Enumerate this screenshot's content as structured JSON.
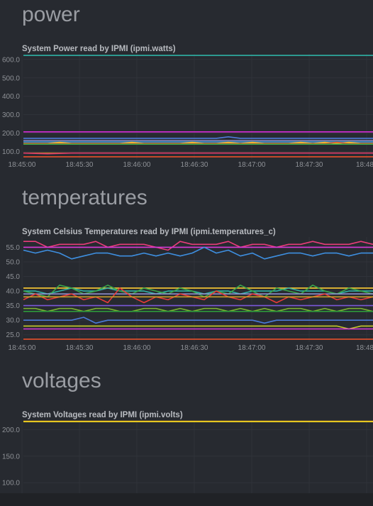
{
  "sections": [
    {
      "title": "power"
    },
    {
      "title": "temperatures"
    },
    {
      "title": "voltages"
    }
  ],
  "chart_data": [
    {
      "type": "line",
      "title": "System Power read by IPMI (ipmi.watts)",
      "xlabel": "",
      "ylabel": "",
      "x_ticks": [
        "18:45:00",
        "18:45:30",
        "18:46:00",
        "18:46:30",
        "18:47:00",
        "18:47:30",
        "18:48:"
      ],
      "y_ticks": [
        "100.0",
        "200.0",
        "300.0",
        "400.0",
        "500.0",
        "600.0"
      ],
      "ylim": [
        60,
        630
      ],
      "grid": true,
      "series": [
        {
          "color": "#2fb2a6",
          "values": [
            622,
            622,
            622,
            622,
            622,
            622,
            622,
            622,
            622,
            622,
            622,
            622,
            622,
            622,
            622,
            622,
            622,
            622,
            622,
            622,
            622,
            622,
            622,
            622,
            622,
            622,
            622,
            622,
            622,
            622
          ]
        },
        {
          "color": "#d62cd6",
          "values": [
            207,
            207,
            207,
            207,
            207,
            207,
            207,
            207,
            207,
            207,
            207,
            207,
            207,
            207,
            207,
            207,
            207,
            207,
            207,
            207,
            207,
            207,
            207,
            207,
            207,
            207,
            207,
            207,
            207,
            207
          ]
        },
        {
          "color": "#4f7ad8",
          "values": [
            172,
            172,
            172,
            172,
            172,
            172,
            172,
            172,
            172,
            172,
            172,
            172,
            172,
            172,
            172,
            172,
            172,
            180,
            172,
            172,
            172,
            172,
            172,
            172,
            172,
            172,
            172,
            172,
            172,
            172
          ]
        },
        {
          "color": "#8e8ec8",
          "values": [
            160,
            160,
            160,
            160,
            160,
            160,
            160,
            160,
            160,
            160,
            160,
            160,
            160,
            160,
            160,
            160,
            160,
            160,
            160,
            160,
            160,
            160,
            160,
            160,
            160,
            160,
            160,
            160,
            160,
            160
          ]
        },
        {
          "color": "#3a9ad9",
          "values": [
            152,
            152,
            152,
            152,
            152,
            152,
            152,
            152,
            152,
            152,
            152,
            152,
            152,
            152,
            152,
            152,
            152,
            152,
            152,
            152,
            152,
            152,
            152,
            152,
            152,
            152,
            152,
            152,
            152,
            152
          ]
        },
        {
          "color": "#ffcc33",
          "values": [
            144,
            144,
            144,
            150,
            144,
            144,
            144,
            144,
            144,
            150,
            144,
            144,
            144,
            144,
            150,
            144,
            144,
            150,
            144,
            150,
            144,
            144,
            144,
            150,
            144,
            150,
            144,
            150,
            144,
            144
          ]
        },
        {
          "color": "#e05a28",
          "values": [
            144,
            144,
            144,
            144,
            144,
            144,
            144,
            144,
            144,
            144,
            144,
            144,
            144,
            144,
            144,
            144,
            144,
            144,
            144,
            144,
            144,
            144,
            144,
            144,
            144,
            144,
            150,
            144,
            144,
            144
          ]
        },
        {
          "color": "#3aa64a",
          "values": [
            140,
            140,
            140,
            140,
            140,
            140,
            140,
            140,
            140,
            140,
            140,
            140,
            140,
            140,
            140,
            140,
            140,
            140,
            140,
            140,
            140,
            140,
            140,
            140,
            140,
            140,
            140,
            140,
            140,
            140
          ]
        },
        {
          "color": "#c98a2a",
          "values": [
            92,
            92,
            92,
            92,
            92,
            92,
            92,
            92,
            92,
            92,
            92,
            92,
            92,
            92,
            92,
            92,
            92,
            92,
            92,
            92,
            92,
            92,
            92,
            92,
            92,
            92,
            92,
            92,
            92,
            92
          ]
        },
        {
          "color": "#d83a6a",
          "values": [
            92,
            90,
            88,
            90,
            92,
            92,
            92,
            92,
            92,
            92,
            92,
            92,
            92,
            92,
            92,
            92,
            92,
            92,
            92,
            92,
            92,
            92,
            92,
            92,
            92,
            92,
            92,
            92,
            92,
            92
          ]
        },
        {
          "color": "#e8502a",
          "values": [
            72,
            72,
            72,
            72,
            72,
            72,
            72,
            72,
            72,
            72,
            72,
            72,
            72,
            72,
            72,
            72,
            72,
            72,
            72,
            72,
            72,
            72,
            72,
            72,
            72,
            72,
            72,
            72,
            72,
            72
          ]
        }
      ]
    },
    {
      "type": "line",
      "title": "System Celsius Temperatures read by IPMI (ipmi.temperatures_c)",
      "xlabel": "",
      "ylabel": "",
      "x_ticks": [
        "18:45:00",
        "18:45:30",
        "18:46:00",
        "18:46:30",
        "18:47:00",
        "18:47:30",
        "18:48:"
      ],
      "y_ticks": [
        "25.0",
        "30.0",
        "35.0",
        "40.0",
        "45.0",
        "50.0",
        "55.0"
      ],
      "ylim": [
        22.5,
        58.5
      ],
      "grid": true,
      "series": [
        {
          "color": "#e83c7a",
          "values": [
            57,
            57,
            55,
            56,
            56,
            56,
            57,
            55,
            56,
            56,
            56,
            55,
            54,
            57,
            56,
            56,
            56,
            57,
            55,
            56,
            56,
            55,
            56,
            56,
            57,
            56,
            56,
            56,
            57,
            56
          ]
        },
        {
          "color": "#d83ad8",
          "values": [
            55,
            55,
            55,
            55,
            55,
            55,
            55,
            55,
            55,
            55,
            55,
            55,
            55,
            55,
            55,
            55,
            55,
            55,
            55,
            55,
            55,
            55,
            55,
            55,
            55,
            55,
            55,
            55,
            55,
            55
          ]
        },
        {
          "color": "#3e8fe0",
          "values": [
            54,
            53,
            54,
            53,
            51,
            52,
            53,
            53,
            52,
            52,
            53,
            52,
            53,
            52,
            53,
            55,
            53,
            54,
            52,
            53,
            51,
            52,
            53,
            53,
            52,
            53,
            53,
            52,
            53,
            53
          ]
        },
        {
          "color": "#ffcc33",
          "values": [
            41,
            41,
            41,
            41,
            41,
            41,
            41,
            41,
            41,
            41,
            41,
            41,
            41,
            41,
            41,
            41,
            41,
            41,
            41,
            41,
            41,
            41,
            41,
            41,
            41,
            41,
            41,
            41,
            41,
            41
          ]
        },
        {
          "color": "#2fb2a6",
          "values": [
            40,
            40,
            39,
            40,
            41,
            40,
            40,
            41,
            40,
            40,
            40,
            39,
            40,
            40,
            40,
            39,
            40,
            40,
            39,
            40,
            40,
            40,
            41,
            40,
            40,
            40,
            39,
            40,
            40,
            40
          ]
        },
        {
          "color": "#3aa64a",
          "values": [
            40,
            39,
            38,
            42,
            41,
            39,
            40,
            42,
            40,
            39,
            41,
            40,
            39,
            41,
            40,
            38,
            40,
            39,
            42,
            40,
            38,
            41,
            40,
            39,
            42,
            40,
            39,
            41,
            40,
            39
          ]
        },
        {
          "color": "#8e8ec8",
          "values": [
            39,
            39,
            39,
            39,
            39,
            39,
            39,
            39,
            39,
            39,
            39,
            39,
            39,
            39,
            39,
            39,
            39,
            39,
            39,
            39,
            39,
            39,
            39,
            39,
            39,
            39,
            39,
            39,
            39,
            39
          ]
        },
        {
          "color": "#e83a3a",
          "values": [
            37,
            39,
            37,
            38,
            39,
            37,
            38,
            36,
            41,
            38,
            36,
            38,
            37,
            39,
            38,
            37,
            40,
            38,
            37,
            39,
            38,
            36,
            38,
            37,
            38,
            39,
            37,
            38,
            37,
            38
          ]
        },
        {
          "color": "#c9a02a",
          "values": [
            38,
            38,
            38,
            38,
            38,
            38,
            38,
            38,
            38,
            38,
            38,
            38,
            38,
            38,
            38,
            38,
            38,
            38,
            38,
            38,
            38,
            38,
            38,
            38,
            38,
            38,
            38,
            38,
            38,
            38
          ]
        },
        {
          "color": "#7a58d8",
          "values": [
            35,
            35,
            35,
            35,
            35,
            35,
            35,
            35,
            35,
            35,
            35,
            35,
            35,
            35,
            35,
            35,
            35,
            35,
            35,
            35,
            35,
            35,
            35,
            35,
            35,
            35,
            35,
            35,
            35,
            35
          ]
        },
        {
          "color": "#7ab030",
          "values": [
            34,
            34,
            33,
            34,
            34,
            33,
            34,
            34,
            33,
            33,
            34,
            34,
            33,
            34,
            33,
            34,
            34,
            33,
            34,
            33,
            34,
            33,
            34,
            34,
            33,
            34,
            33,
            34,
            34,
            33
          ]
        },
        {
          "color": "#2e9a3a",
          "values": [
            33,
            33,
            33,
            33,
            33,
            33,
            33,
            33,
            33,
            33,
            33,
            33,
            33,
            33,
            33,
            33,
            33,
            33,
            33,
            33,
            33,
            33,
            33,
            33,
            33,
            33,
            33,
            33,
            33,
            33
          ]
        },
        {
          "color": "#4a7ad8",
          "values": [
            30,
            30,
            30,
            30,
            30,
            31,
            29,
            30,
            30,
            30,
            30,
            30,
            30,
            30,
            30,
            30,
            30,
            30,
            30,
            30,
            29,
            30,
            30,
            30,
            30,
            30,
            30,
            30,
            30,
            30
          ]
        },
        {
          "color": "#c9c92a",
          "values": [
            28,
            28,
            28,
            28,
            28,
            28,
            28,
            28,
            28,
            28,
            28,
            28,
            28,
            28,
            28,
            28,
            28,
            28,
            28,
            28,
            28,
            28,
            28,
            28,
            28,
            28,
            28,
            27,
            28,
            28
          ]
        },
        {
          "color": "#d83ad8",
          "values": [
            27,
            27,
            27,
            27,
            27,
            27,
            27,
            27,
            27,
            27,
            27,
            27,
            27,
            27,
            27,
            27,
            27,
            27,
            27,
            27,
            27,
            27,
            27,
            27,
            27,
            27,
            27,
            27,
            27,
            27
          ]
        },
        {
          "color": "#e8502a",
          "values": [
            23.5,
            23.5,
            23.5,
            23.5,
            23.5,
            23.5,
            23.5,
            23.5,
            23.5,
            23.5,
            23.5,
            23.5,
            23.5,
            23.5,
            23.5,
            23.5,
            23.5,
            23.5,
            23.5,
            23.5,
            23.5,
            23.5,
            23.5,
            23.5,
            23.5,
            23.5,
            23.5,
            23.5,
            23.5,
            23.5
          ]
        }
      ]
    },
    {
      "type": "line",
      "title": "System Voltages read by IPMI (ipmi.volts)",
      "xlabel": "",
      "ylabel": "",
      "x_ticks": [],
      "y_ticks": [
        "100.0",
        "150.0",
        "200.0"
      ],
      "ylim": [
        80,
        218
      ],
      "grid": true,
      "series": [
        {
          "color": "#e0a020",
          "values": [
            216,
            216,
            216,
            216,
            216,
            216,
            216,
            216,
            216,
            216,
            216,
            216,
            216,
            216,
            216,
            216,
            216,
            216,
            216,
            216,
            216,
            216,
            216,
            216,
            216,
            216,
            216,
            216,
            216,
            216
          ]
        },
        {
          "color": "#e8d020",
          "values": [
            215,
            215,
            215,
            215,
            215,
            215,
            215,
            215,
            215,
            215,
            215,
            215,
            215,
            215,
            215,
            215,
            215,
            215,
            215,
            215,
            215,
            215,
            215,
            215,
            215,
            215,
            215,
            215,
            215,
            215
          ]
        }
      ]
    }
  ]
}
